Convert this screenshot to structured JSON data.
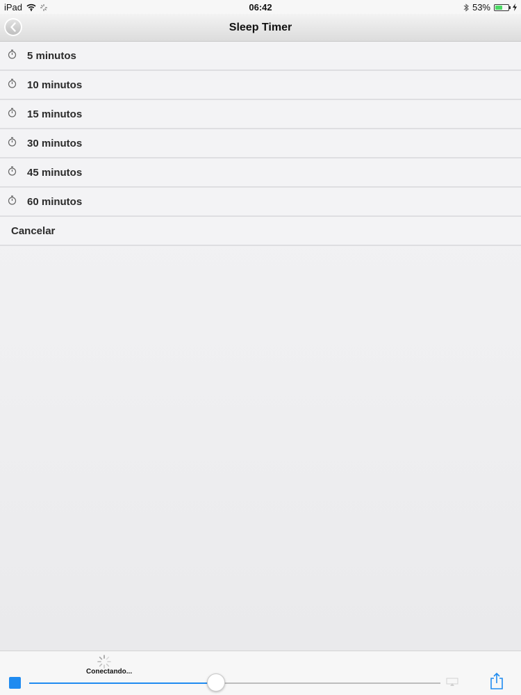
{
  "status_bar": {
    "device": "iPad",
    "time": "06:42",
    "battery_text": "53%",
    "battery_level": 0.53
  },
  "nav": {
    "title": "Sleep Timer"
  },
  "timer_options": [
    {
      "label": "5 minutos"
    },
    {
      "label": "10 minutos"
    },
    {
      "label": "15 minutos"
    },
    {
      "label": "30 minutos"
    },
    {
      "label": "45 minutos"
    },
    {
      "label": "60 minutos"
    }
  ],
  "cancel_label": "Cancelar",
  "player": {
    "status_text": "Conectando...",
    "progress": 0.455
  },
  "colors": {
    "accent": "#1f8bf0",
    "battery": "#4cd964"
  }
}
